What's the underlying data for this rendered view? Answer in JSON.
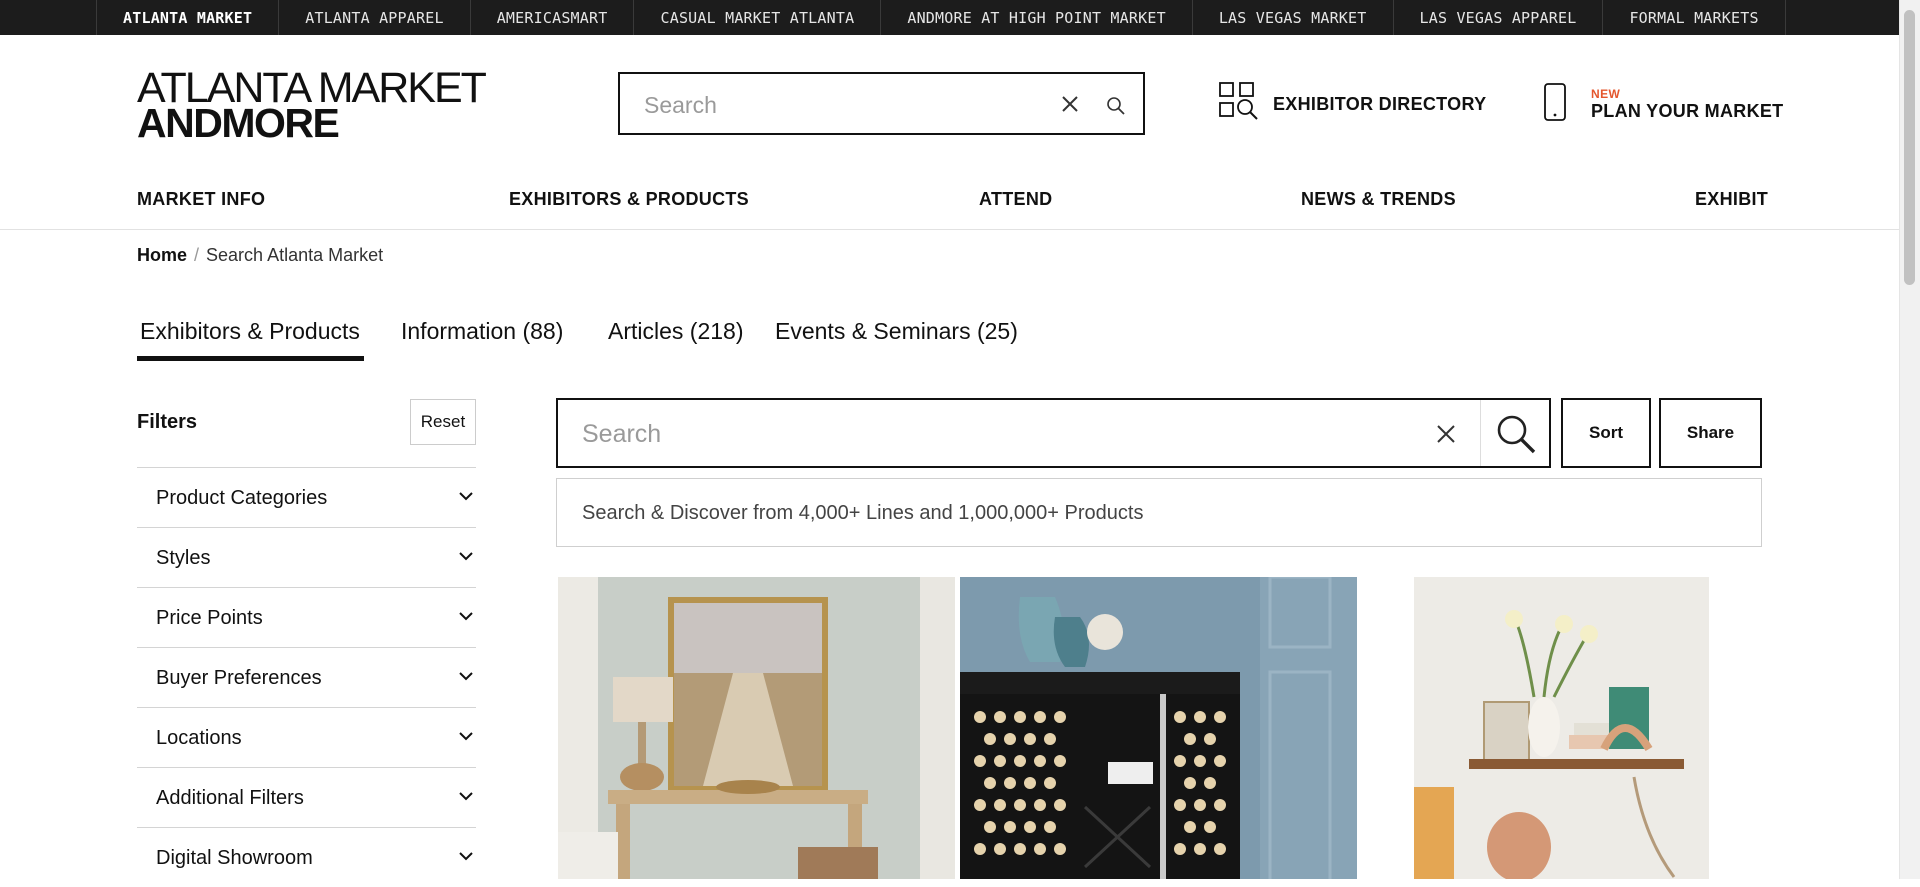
{
  "topbar": {
    "tabs": [
      {
        "label": "ATLANTA MARKET",
        "active": true
      },
      {
        "label": "ATLANTA APPAREL"
      },
      {
        "label": "AMERICASMART"
      },
      {
        "label": "CASUAL MARKET ATLANTA"
      },
      {
        "label": "ANDMORE AT HIGH POINT MARKET"
      },
      {
        "label": "LAS VEGAS MARKET"
      },
      {
        "label": "LAS VEGAS APPAREL"
      },
      {
        "label": "FORMAL MARKETS"
      }
    ]
  },
  "header": {
    "logo_line1": "ATLANTA MARKET",
    "logo_line2": "ANDMORE",
    "search_placeholder": "Search",
    "exhibitor_directory": "EXHIBITOR DIRECTORY",
    "plan_badge": "NEW",
    "plan_label": "PLAN YOUR MARKET"
  },
  "nav": {
    "items": [
      "MARKET INFO",
      "EXHIBITORS & PRODUCTS",
      "ATTEND",
      "NEWS & TRENDS",
      "EXHIBIT"
    ]
  },
  "breadcrumb": {
    "home": "Home",
    "separator": "/",
    "current": "Search Atlanta Market"
  },
  "tabs": [
    {
      "label": "Exhibitors & Products",
      "active": true
    },
    {
      "label": "Information (88)"
    },
    {
      "label": "Articles (218)"
    },
    {
      "label": "Events & Seminars (25)"
    }
  ],
  "filters": {
    "title": "Filters",
    "reset": "Reset",
    "items": [
      "Product Categories",
      "Styles",
      "Price Points",
      "Buyer Preferences",
      "Locations",
      "Additional Filters",
      "Digital Showroom"
    ]
  },
  "results": {
    "search_placeholder": "Search",
    "sort": "Sort",
    "share": "Share",
    "info": "Search & Discover from 4,000+ Lines and 1,000,000+ Products"
  },
  "tiles": [
    "coastal-console-vignette",
    "black-cane-bar-cabinet",
    "shelf-decor-vignette"
  ],
  "colors": {
    "accent_new": "#e4572e",
    "topbar_bg": "#1c1c1c"
  }
}
